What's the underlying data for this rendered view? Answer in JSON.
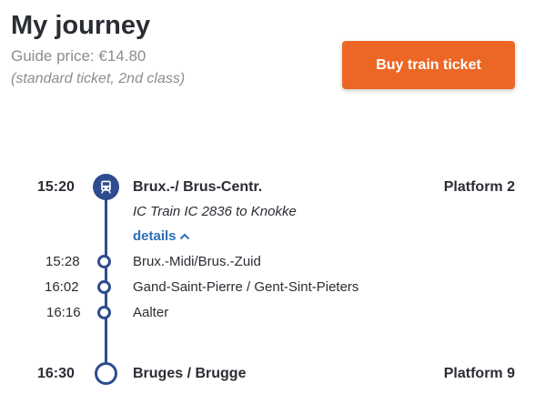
{
  "header": {
    "title": "My journey",
    "guide_price": "Guide price: €14.80",
    "ticket_note": "(standard ticket, 2nd class)",
    "buy_button_label": "Buy train ticket"
  },
  "journey": {
    "departure": {
      "time": "15:20",
      "station": "Brux.-/ Brus-Centr.",
      "platform": "Platform 2"
    },
    "train_info": "IC Train IC 2836 to Knokke",
    "details_label": "details",
    "intermediate_stops": [
      {
        "time": "15:28",
        "station": "Brux.-Midi/Brus.-Zuid"
      },
      {
        "time": "16:02",
        "station": "Gand-Saint-Pierre / Gent-Sint-Pieters"
      },
      {
        "time": "16:16",
        "station": "Aalter"
      }
    ],
    "arrival": {
      "time": "16:30",
      "station": "Bruges / Brugge",
      "platform": "Platform 9"
    }
  },
  "colors": {
    "accent": "#ec6726",
    "route_line": "#2e4c8f",
    "link": "#2b6fb6"
  },
  "icons": [
    "train-icon",
    "chevron-up-icon"
  ]
}
